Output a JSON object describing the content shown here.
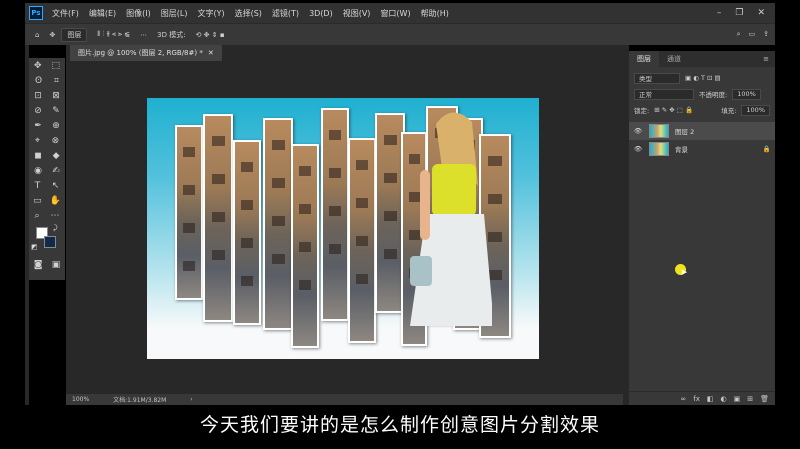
{
  "app": {
    "logo": "Ps"
  },
  "menu": [
    "文件(F)",
    "编辑(E)",
    "图像(I)",
    "图层(L)",
    "文字(Y)",
    "选择(S)",
    "滤镜(T)",
    "3D(D)",
    "视图(V)",
    "窗口(W)",
    "帮助(H)"
  ],
  "window_controls": {
    "minimize": "–",
    "restore": "❐",
    "close": "✕"
  },
  "options_bar": {
    "home": "⌂",
    "move": "✥",
    "auto_select": "图层",
    "three_d_mode": "3D 模式:",
    "search": "⌕",
    "workspace": "▭",
    "share": "⇪"
  },
  "document": {
    "tab_title": "图片.jpg @ 100% (图层 2, RGB/8#) *",
    "tab_close": "✕"
  },
  "status_bar": {
    "zoom": "100%",
    "doc_info": "文档:1.91M/3.82M",
    "arrow": "›"
  },
  "tools": [
    [
      "✥",
      "⬚"
    ],
    [
      "ʘ",
      "⌗"
    ],
    [
      "⊡",
      "⊠"
    ],
    [
      "⊘",
      "✎"
    ],
    [
      "✒",
      "⊕"
    ],
    [
      "⌖",
      "⊗"
    ],
    [
      "◼",
      "◆"
    ],
    [
      "◉",
      "✍"
    ],
    [
      "T",
      "↖"
    ],
    [
      "▭",
      "✋"
    ],
    [
      "⌕",
      "⋯"
    ]
  ],
  "layers_panel": {
    "tabs": [
      "图层",
      "通道"
    ],
    "menu": "≡",
    "kind": "类型",
    "blend_mode": "正常",
    "opacity_label": "不透明度:",
    "opacity": "100%",
    "lock_label": "锁定:",
    "fill_label": "填充:",
    "fill": "100%",
    "layers": [
      {
        "name": "图层 2",
        "selected": true,
        "lock": ""
      },
      {
        "name": "背景",
        "selected": false,
        "lock": "🔒"
      }
    ],
    "bottom_icons": [
      "∞",
      "fx",
      "◧",
      "◐",
      "▣",
      "⊞",
      "🗑"
    ]
  },
  "subtitle": "今天我们要讲的是怎么制作创意图片分割效果",
  "colors": {
    "foreground": "#ffffff",
    "background": "#0f2a4a",
    "cursor_dot": "#f2e21a"
  }
}
